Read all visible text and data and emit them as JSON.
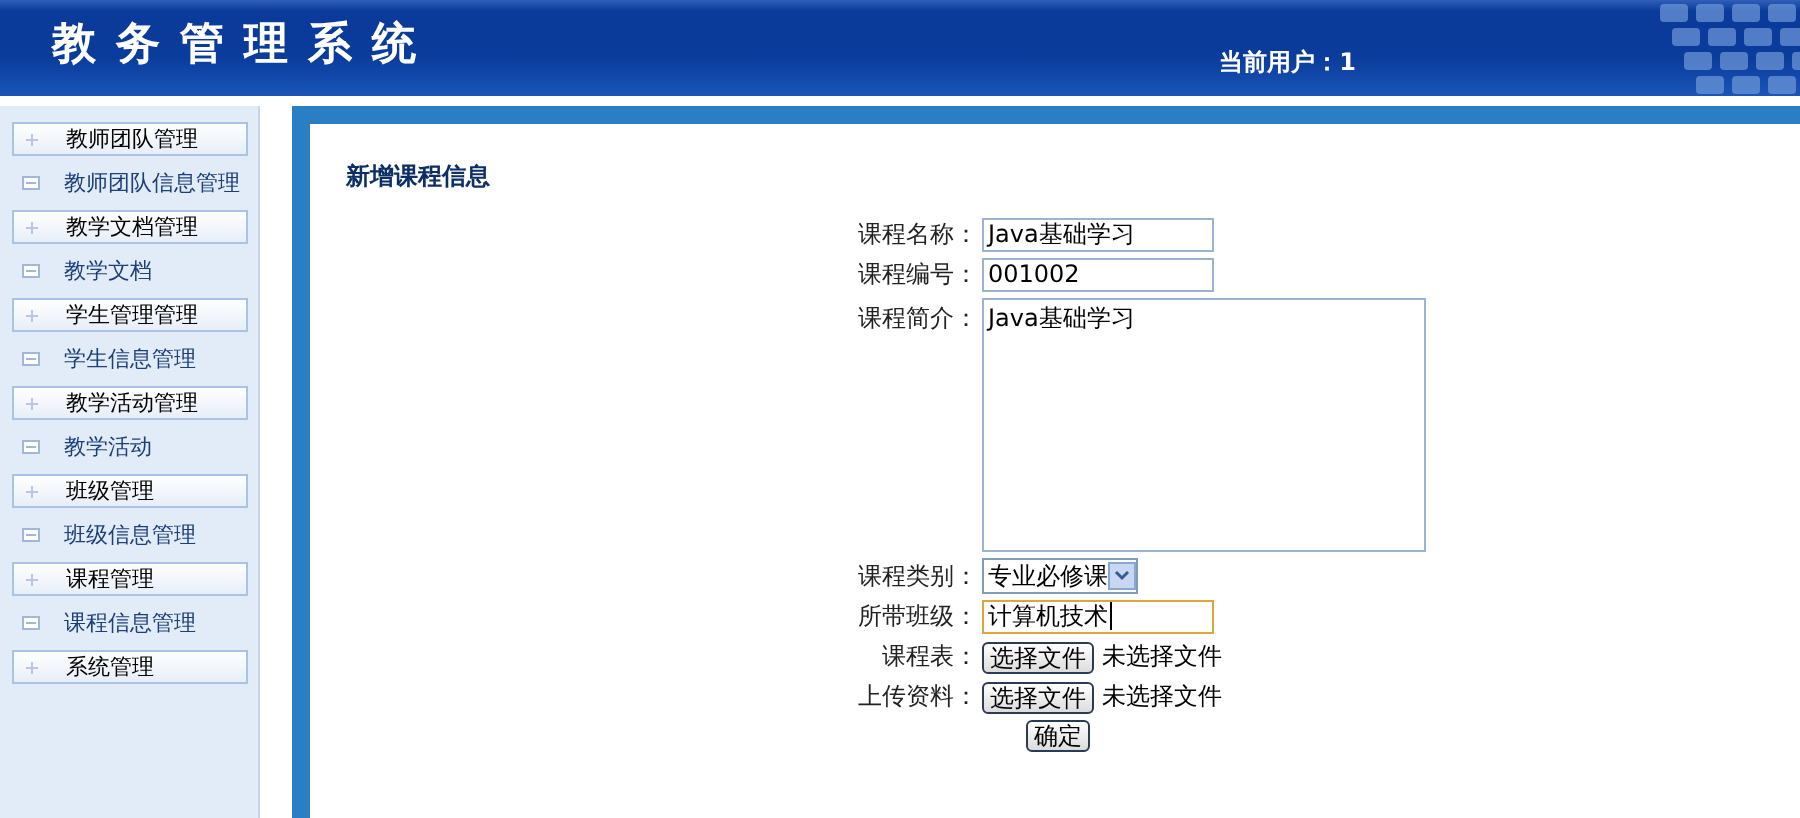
{
  "header": {
    "title": "教务管理系统",
    "user_label": "当前用户：1"
  },
  "sidebar": {
    "items": [
      {
        "kind": "group",
        "label": "教师团队管理"
      },
      {
        "kind": "link",
        "label": "教师团队信息管理"
      },
      {
        "kind": "group",
        "label": "教学文档管理"
      },
      {
        "kind": "link",
        "label": "教学文档"
      },
      {
        "kind": "group",
        "label": "学生管理管理"
      },
      {
        "kind": "link",
        "label": "学生信息管理"
      },
      {
        "kind": "group",
        "label": "教学活动管理"
      },
      {
        "kind": "link",
        "label": "教学活动"
      },
      {
        "kind": "group",
        "label": "班级管理"
      },
      {
        "kind": "link",
        "label": "班级信息管理"
      },
      {
        "kind": "group",
        "label": "课程管理"
      },
      {
        "kind": "link",
        "label": "课程信息管理"
      },
      {
        "kind": "group",
        "label": "系统管理"
      }
    ]
  },
  "form": {
    "title": "新增课程信息",
    "fields": [
      {
        "kind": "text",
        "label": "课程名称：",
        "value": "Java基础学习",
        "focused": false
      },
      {
        "kind": "text",
        "label": "课程编号：",
        "value": "001002",
        "focused": false
      },
      {
        "kind": "textarea",
        "label": "课程简介：",
        "value": "Java基础学习"
      },
      {
        "kind": "select",
        "label": "课程类别：",
        "value": "专业必修课"
      },
      {
        "kind": "text",
        "label": "所带班级：",
        "value": "计算机技术",
        "focused": true
      },
      {
        "kind": "file",
        "label": "课程表：",
        "button": "选择文件",
        "status": "未选择文件"
      },
      {
        "kind": "file",
        "label": "上传资料：",
        "button": "选择文件",
        "status": "未选择文件"
      }
    ],
    "submit": "确定"
  }
}
